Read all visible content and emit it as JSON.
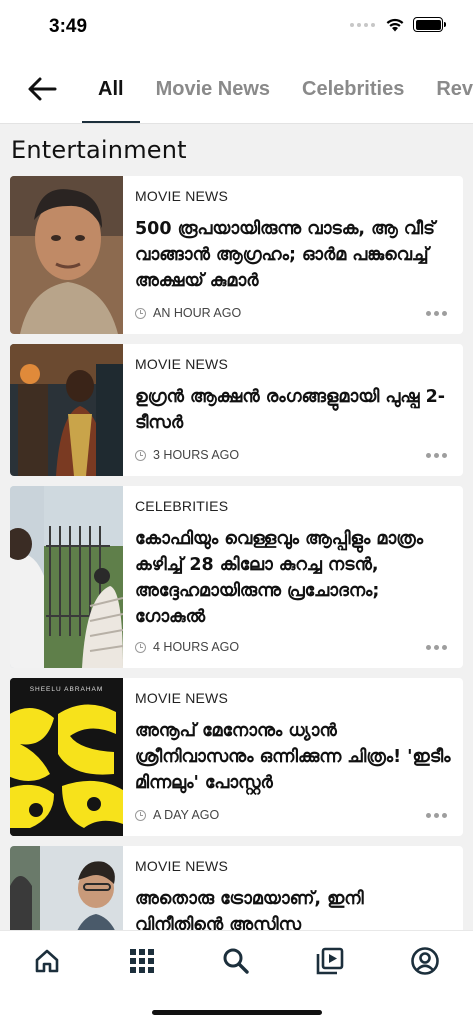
{
  "status_bar": {
    "time": "3:49"
  },
  "tabs": [
    {
      "label": "All",
      "active": true
    },
    {
      "label": "Movie News",
      "active": false
    },
    {
      "label": "Celebrities",
      "active": false
    },
    {
      "label": "Reviews",
      "active": false
    }
  ],
  "section": {
    "title": "Entertainment"
  },
  "articles": [
    {
      "category": "MOVIE NEWS",
      "headline": "500 രൂപയായിരുന്നു വാടക, ആ വീട് വാങ്ങാൻ ആഗ്രഹം; ഓർമ പങ്കുവെച്ച് അക്ഷയ് കുമാർ",
      "time": "AN HOUR AGO",
      "thumb_icon": "portrait-photo"
    },
    {
      "category": "MOVIE NEWS",
      "headline": "ഉഗ്രൻ ആക്ഷൻ രംഗങ്ങളുമായി പുഷ്പ 2- ടീസർ",
      "time": "3 HOURS AGO",
      "thumb_icon": "movie-still-photo"
    },
    {
      "category": "CELEBRITIES",
      "headline": "കോഫിയും വെള്ളവും ആപ്പിളും മാത്രം കഴിച്ച് 28 കിലോ കുറച്ച നടൻ, അദ്ദേഹമായിരുന്നു പ്രചോദനം; ഗോകുൽ",
      "time": "4 HOURS AGO",
      "thumb_icon": "outdoor-photo"
    },
    {
      "category": "MOVIE NEWS",
      "headline": "അനൂപ് മേനോനും ധ്യാൻ ശ്രീനിവാസനും ഒന്നിക്കുന്ന ചിത്രം! 'ഇടീം മിന്നലും' പോസ്റ്റർ",
      "time": "A DAY AGO",
      "thumb_icon": "movie-poster",
      "poster_credit": "SHEELU ABRAHAM"
    },
    {
      "category": "MOVIE NEWS",
      "headline": "അതൊരു ട്രോമയാണ്, ഇനി വിനീതിൻെ അസിസ്റ്റ",
      "time": "",
      "thumb_icon": "portrait-photo"
    }
  ],
  "bottom_nav": [
    {
      "icon": "home-icon"
    },
    {
      "icon": "grid-icon"
    },
    {
      "icon": "search-icon"
    },
    {
      "icon": "video-library-icon"
    },
    {
      "icon": "profile-icon"
    }
  ],
  "colors": {
    "active_indicator": "#1c2f3c",
    "background": "#f1f1f1",
    "poster_yellow": "#f7e21b"
  }
}
